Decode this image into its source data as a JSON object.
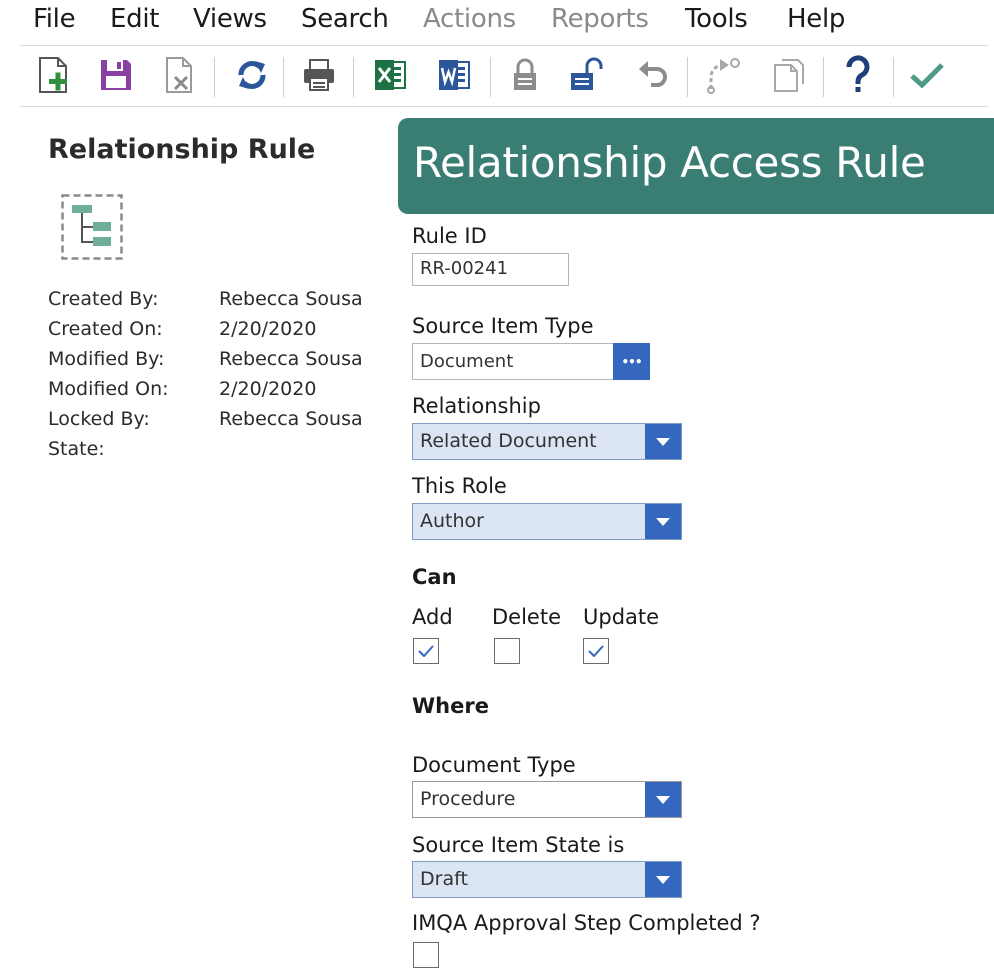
{
  "menu": {
    "items": [
      {
        "label": "File",
        "disabled": false
      },
      {
        "label": "Edit",
        "disabled": false
      },
      {
        "label": "Views",
        "disabled": false
      },
      {
        "label": "Search",
        "disabled": false
      },
      {
        "label": "Actions",
        "disabled": true
      },
      {
        "label": "Reports",
        "disabled": true
      },
      {
        "label": "Tools",
        "disabled": false
      },
      {
        "label": "Help",
        "disabled": false
      }
    ]
  },
  "toolbar": {
    "icons": [
      "new-item-icon",
      "save-icon",
      "discard-icon",
      "refresh-icon",
      "print-icon",
      "export-excel-icon",
      "export-word-icon",
      "lock-icon",
      "unlock-icon",
      "undo-icon",
      "promote-icon",
      "copy-icon",
      "help-icon",
      "done-icon"
    ]
  },
  "colors": {
    "accent_header": "#3a7e73",
    "button_blue": "#3467bd",
    "select_fill": "#dbe5f3",
    "save_purple": "#8a3fa3",
    "excel_green": "#1e7145",
    "word_blue": "#2b579a",
    "done_green": "#4b9b86"
  },
  "left": {
    "title": "Relationship Rule",
    "meta": [
      {
        "label": "Created By:",
        "value": "Rebecca Sousa"
      },
      {
        "label": "Created On:",
        "value": "2/20/2020"
      },
      {
        "label": "Modified By:",
        "value": "Rebecca Sousa"
      },
      {
        "label": "Modified On:",
        "value": "2/20/2020"
      },
      {
        "label": "Locked By:",
        "value": "Rebecca Sousa"
      },
      {
        "label": "State:",
        "value": ""
      }
    ]
  },
  "form": {
    "header_title": "Relationship Access Rule",
    "rule_id_label": "Rule ID",
    "rule_id_value": "RR-00241",
    "source_item_type_label": "Source Item Type",
    "source_item_type_value": "Document",
    "lookup_glyph": "•••",
    "relationship_label": "Relationship",
    "relationship_value": "Related Document",
    "this_role_label": "This Role",
    "this_role_value": "Author",
    "can_label": "Can",
    "add_label": "Add",
    "delete_label": "Delete",
    "update_label": "Update",
    "add_checked": true,
    "delete_checked": false,
    "update_checked": true,
    "where_label": "Where",
    "document_type_label": "Document Type",
    "document_type_value": "Procedure",
    "source_item_state_label": "Source Item State is",
    "source_item_state_value": "Draft",
    "imqa_label": "IMQA Approval Step Completed ?",
    "imqa_checked": false
  }
}
